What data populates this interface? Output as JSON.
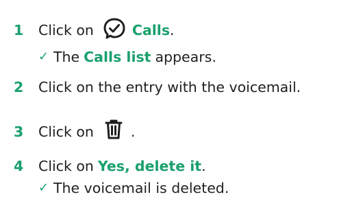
{
  "steps": [
    {
      "number": "1",
      "prefix": "Click on",
      "icon": "calls-icon",
      "accent": "Calls",
      "suffix": ".",
      "result": {
        "check": "✓",
        "prefix": "The",
        "accent": "Calls list",
        "suffix": "appears."
      }
    },
    {
      "number": "2",
      "text": "Click on the entry with the voicemail."
    },
    {
      "number": "3",
      "prefix": "Click on",
      "icon": "trash-icon",
      "suffix": "."
    },
    {
      "number": "4",
      "prefix": "Click on",
      "accent": "Yes, delete it",
      "suffix": ".",
      "result": {
        "check": "✓",
        "text": "The voicemail is deleted."
      }
    }
  ],
  "colors": {
    "accent": "#1aa06d",
    "text": "#1f1f1f"
  }
}
